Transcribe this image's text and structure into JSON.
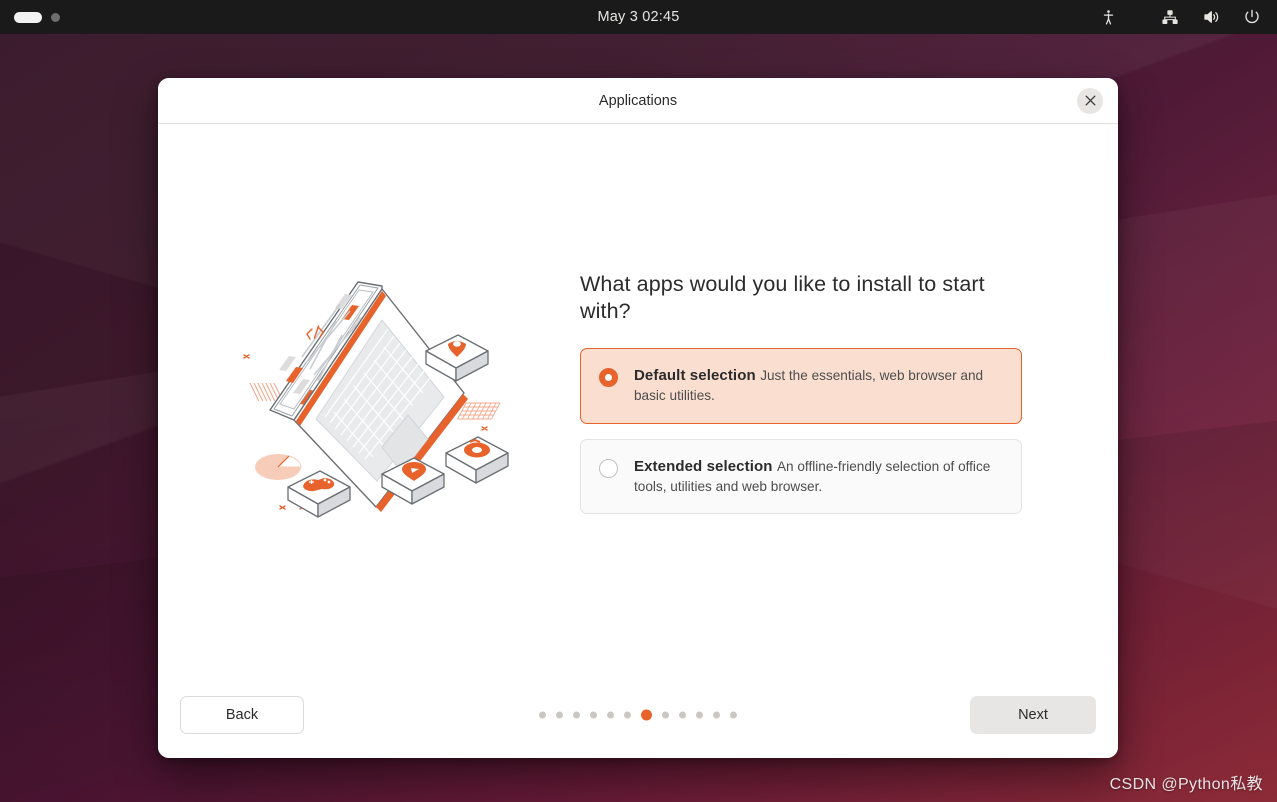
{
  "topbar": {
    "clock": "May 3  02:45",
    "workspace_indicator": "workspace-pills",
    "icons": [
      {
        "name": "accessibility-icon",
        "label": "Accessibility"
      },
      {
        "name": "network-wired-icon",
        "label": "Network"
      },
      {
        "name": "volume-icon",
        "label": "Volume"
      },
      {
        "name": "power-icon",
        "label": "Power"
      }
    ]
  },
  "dialog": {
    "title": "Applications",
    "close_label": "×",
    "heading": "What apps would you like to install to start with?",
    "options": [
      {
        "title": "Default selection",
        "description": "Just the essentials, web browser and basic utilities.",
        "selected": true
      },
      {
        "title": "Extended selection",
        "description": "An offline-friendly selection of office tools, utilities and web browser.",
        "selected": false
      }
    ],
    "footer": {
      "back_label": "Back",
      "next_label": "Next",
      "dots_total": 12,
      "dots_active_index": 7
    }
  },
  "illustration": {
    "name": "isometric-laptop-apps-illustration",
    "tiles": [
      "map-pin-icon",
      "camera-icon",
      "media-play-icon",
      "gamepad-icon"
    ]
  },
  "watermark": "CSDN @Python私教",
  "colors": {
    "accent": "#e8622c",
    "selected_card_bg": "#fadfd1",
    "topbar_bg": "#1a1a1a",
    "dialog_bg": "#ffffff"
  }
}
